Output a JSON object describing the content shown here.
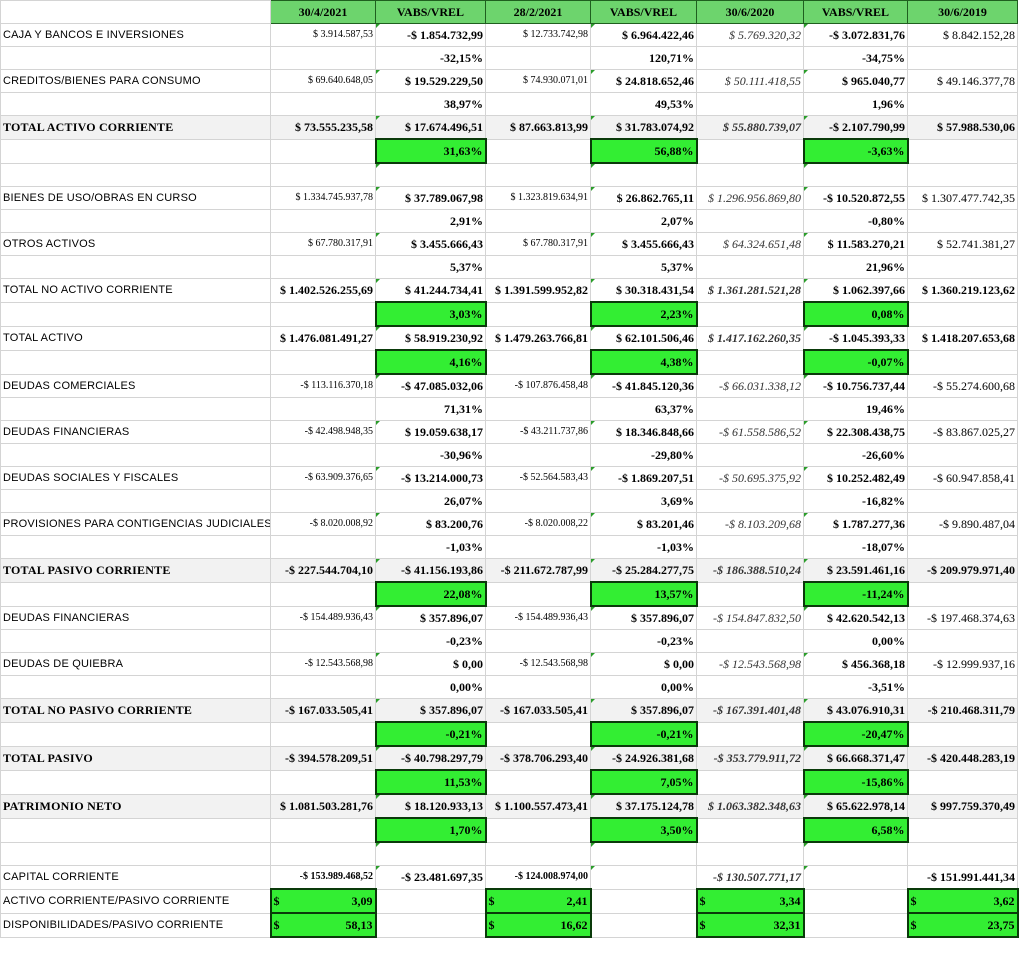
{
  "header": [
    "",
    "30/4/2021",
    "VABS/VREL",
    "28/2/2021",
    "VABS/VREL",
    "30/6/2020",
    "VABS/VREL",
    "30/6/2019"
  ],
  "rows": [
    {
      "label": "CAJA Y BANCOS E INVERSIONES",
      "c1": "$ 3.914.587,53",
      "c2": "-$ 1.854.732,99",
      "c3": "$ 12.733.742,98",
      "c4": "$ 6.964.422,46",
      "c5": "$ 5.769.320,32",
      "c6": "-$ 3.072.831,76",
      "c7": "$ 8.842.152,28"
    },
    {
      "label": "",
      "c2": "-32,15%",
      "c4": "120,71%",
      "c6": "-34,75%"
    },
    {
      "label": "CREDITOS/BIENES PARA CONSUMO",
      "c1": "$ 69.640.648,05",
      "c2": "$ 19.529.229,50",
      "c3": "$ 74.930.071,01",
      "c4": "$ 24.818.652,46",
      "c5": "$ 50.111.418,55",
      "c6": "$ 965.040,77",
      "c7": "$ 49.146.377,78"
    },
    {
      "label": "",
      "c2": "38,97%",
      "c4": "49,53%",
      "c6": "1,96%"
    },
    {
      "label": "TOTAL ACTIVO CORRIENTE",
      "c1": "$ 73.555.235,58",
      "c2": "$ 17.674.496,51",
      "c3": "$ 87.663.813,99",
      "c4": "$ 31.783.074,92",
      "c5": "$ 55.880.739,07",
      "c6": "-$ 2.107.790,99",
      "c7": "$ 57.988.530,06"
    },
    {
      "label": "",
      "c2": "31,63%",
      "c4": "56,88%",
      "c6": "-3,63%"
    },
    {
      "label": ""
    },
    {
      "label": "BIENES DE USO/OBRAS EN CURSO",
      "c1": "$ 1.334.745.937,78",
      "c2": "$ 37.789.067,98",
      "c3": "$ 1.323.819.634,91",
      "c4": "$ 26.862.765,11",
      "c5": "$ 1.296.956.869,80",
      "c6": "-$ 10.520.872,55",
      "c7": "$ 1.307.477.742,35"
    },
    {
      "label": "",
      "c2": "2,91%",
      "c4": "2,07%",
      "c6": "-0,80%"
    },
    {
      "label": "OTROS ACTIVOS",
      "c1": "$ 67.780.317,91",
      "c2": "$ 3.455.666,43",
      "c3": "$ 67.780.317,91",
      "c4": "$ 3.455.666,43",
      "c5": "$ 64.324.651,48",
      "c6": "$ 11.583.270,21",
      "c7": "$ 52.741.381,27"
    },
    {
      "label": "",
      "c2": "5,37%",
      "c4": "5,37%",
      "c6": "21,96%"
    },
    {
      "label": "TOTAL  NO ACTIVO CORRIENTE",
      "c1": "$ 1.402.526.255,69",
      "c2": "$ 41.244.734,41",
      "c3": "$ 1.391.599.952,82",
      "c4": "$ 30.318.431,54",
      "c5": "$ 1.361.281.521,28",
      "c6": "$ 1.062.397,66",
      "c7": "$ 1.360.219.123,62"
    },
    {
      "label": "",
      "c2": "3,03%",
      "c4": "2,23%",
      "c6": "0,08%"
    },
    {
      "label": "TOTAL ACTIVO",
      "c1": "$ 1.476.081.491,27",
      "c2": "$ 58.919.230,92",
      "c3": "$ 1.479.263.766,81",
      "c4": "$ 62.101.506,46",
      "c5": "$ 1.417.162.260,35",
      "c6": "-$ 1.045.393,33",
      "c7": "$ 1.418.207.653,68"
    },
    {
      "label": "",
      "c2": "4,16%",
      "c4": "4,38%",
      "c6": "-0,07%"
    },
    {
      "label": "DEUDAS COMERCIALES",
      "c1": "-$ 113.116.370,18",
      "c2": "-$ 47.085.032,06",
      "c3": "-$ 107.876.458,48",
      "c4": "-$ 41.845.120,36",
      "c5": "-$ 66.031.338,12",
      "c6": "-$ 10.756.737,44",
      "c7": "-$ 55.274.600,68"
    },
    {
      "label": "",
      "c2": "71,31%",
      "c4": "63,37%",
      "c6": "19,46%"
    },
    {
      "label": "DEUDAS FINANCIERAS",
      "c1": "-$ 42.498.948,35",
      "c2": "$ 19.059.638,17",
      "c3": "-$ 43.211.737,86",
      "c4": "$ 18.346.848,66",
      "c5": "-$ 61.558.586,52",
      "c6": "$ 22.308.438,75",
      "c7": "-$ 83.867.025,27"
    },
    {
      "label": "",
      "c2": "-30,96%",
      "c4": "-29,80%",
      "c6": "-26,60%"
    },
    {
      "label": "DEUDAS SOCIALES Y FISCALES",
      "c1": "-$ 63.909.376,65",
      "c2": "-$ 13.214.000,73",
      "c3": "-$ 52.564.583,43",
      "c4": "-$ 1.869.207,51",
      "c5": "-$ 50.695.375,92",
      "c6": "$ 10.252.482,49",
      "c7": "-$ 60.947.858,41"
    },
    {
      "label": "",
      "c2": "26,07%",
      "c4": "3,69%",
      "c6": "-16,82%"
    },
    {
      "label": "PROVISIONES PARA CONTIGENCIAS JUDICIALES",
      "c1": "-$ 8.020.008,92",
      "c2": "$ 83.200,76",
      "c3": "-$ 8.020.008,22",
      "c4": "$ 83.201,46",
      "c5": "-$ 8.103.209,68",
      "c6": "$ 1.787.277,36",
      "c7": "-$ 9.890.487,04"
    },
    {
      "label": "",
      "c2": "-1,03%",
      "c4": "-1,03%",
      "c6": "-18,07%"
    },
    {
      "label": "TOTAL PASIVO CORRIENTE",
      "c1": "-$ 227.544.704,10",
      "c2": "-$ 41.156.193,86",
      "c3": "-$ 211.672.787,99",
      "c4": "-$ 25.284.277,75",
      "c5": "-$ 186.388.510,24",
      "c6": "$ 23.591.461,16",
      "c7": "-$ 209.979.971,40"
    },
    {
      "label": "",
      "c2": "22,08%",
      "c4": "13,57%",
      "c6": "-11,24%"
    },
    {
      "label": "DEUDAS FINANCIERAS",
      "c1": "-$ 154.489.936,43",
      "c2": "$ 357.896,07",
      "c3": "-$ 154.489.936,43",
      "c4": "$ 357.896,07",
      "c5": "-$ 154.847.832,50",
      "c6": "$ 42.620.542,13",
      "c7": "-$ 197.468.374,63"
    },
    {
      "label": "",
      "c2": "-0,23%",
      "c4": "-0,23%",
      "c6": "0,00%"
    },
    {
      "label": "DEUDAS DE QUIEBRA",
      "c1": "-$ 12.543.568,98",
      "c2": "$ 0,00",
      "c3": "-$ 12.543.568,98",
      "c4": "$ 0,00",
      "c5": "-$ 12.543.568,98",
      "c6": "$ 456.368,18",
      "c7": "-$ 12.999.937,16"
    },
    {
      "label": "",
      "c2": "0,00%",
      "c4": "0,00%",
      "c6": "-3,51%"
    },
    {
      "label": "TOTAL NO PASIVO CORRIENTE",
      "c1": "-$ 167.033.505,41",
      "c2": "$ 357.896,07",
      "c3": "-$ 167.033.505,41",
      "c4": "$ 357.896,07",
      "c5": "-$ 167.391.401,48",
      "c6": "$ 43.076.910,31",
      "c7": "-$ 210.468.311,79"
    },
    {
      "label": "",
      "c2": "-0,21%",
      "c4": "-0,21%",
      "c6": "-20,47%"
    },
    {
      "label": "TOTAL PASIVO",
      "c1": "-$ 394.578.209,51",
      "c2": "-$ 40.798.297,79",
      "c3": "-$ 378.706.293,40",
      "c4": "-$ 24.926.381,68",
      "c5": "-$ 353.779.911,72",
      "c6": "$ 66.668.371,47",
      "c7": "-$ 420.448.283,19"
    },
    {
      "label": "",
      "c2": "11,53%",
      "c4": "7,05%",
      "c6": "-15,86%"
    },
    {
      "label": "PATRIMONIO NETO",
      "c1": "$ 1.081.503.281,76",
      "c2": "$ 18.120.933,13",
      "c3": "$ 1.100.557.473,41",
      "c4": "$ 37.175.124,78",
      "c5": "$ 1.063.382.348,63",
      "c6": "$ 65.622.978,14",
      "c7": "$ 997.759.370,49"
    },
    {
      "label": "",
      "c2": "1,70%",
      "c4": "3,50%",
      "c6": "6,58%"
    },
    {
      "label": ""
    },
    {
      "label": "CAPITAL CORRIENTE",
      "c1": "-$ 153.989.468,52",
      "c2": "-$ 23.481.697,35",
      "c3": "-$ 124.008.974,00",
      "c5": "-$ 130.507.771,17",
      "c7": "-$ 151.991.441,34"
    },
    {
      "label": "ACTIVO CORRIENTE/PASIVO CORRIENTE",
      "c1": "3,09",
      "c3": "2,41",
      "c5": "3,34",
      "c7": "3,62"
    },
    {
      "label": "DISPONIBILIDADES/PASIVO CORRIENTE",
      "c1": "58,13",
      "c3": "16,62",
      "c5": "32,31",
      "c7": "23,75"
    }
  ],
  "currency_symbol": "$",
  "colors": {
    "header_green": "#6dd46d",
    "highlight_green": "#33ee33",
    "border_dark": "#0a3a0a"
  }
}
